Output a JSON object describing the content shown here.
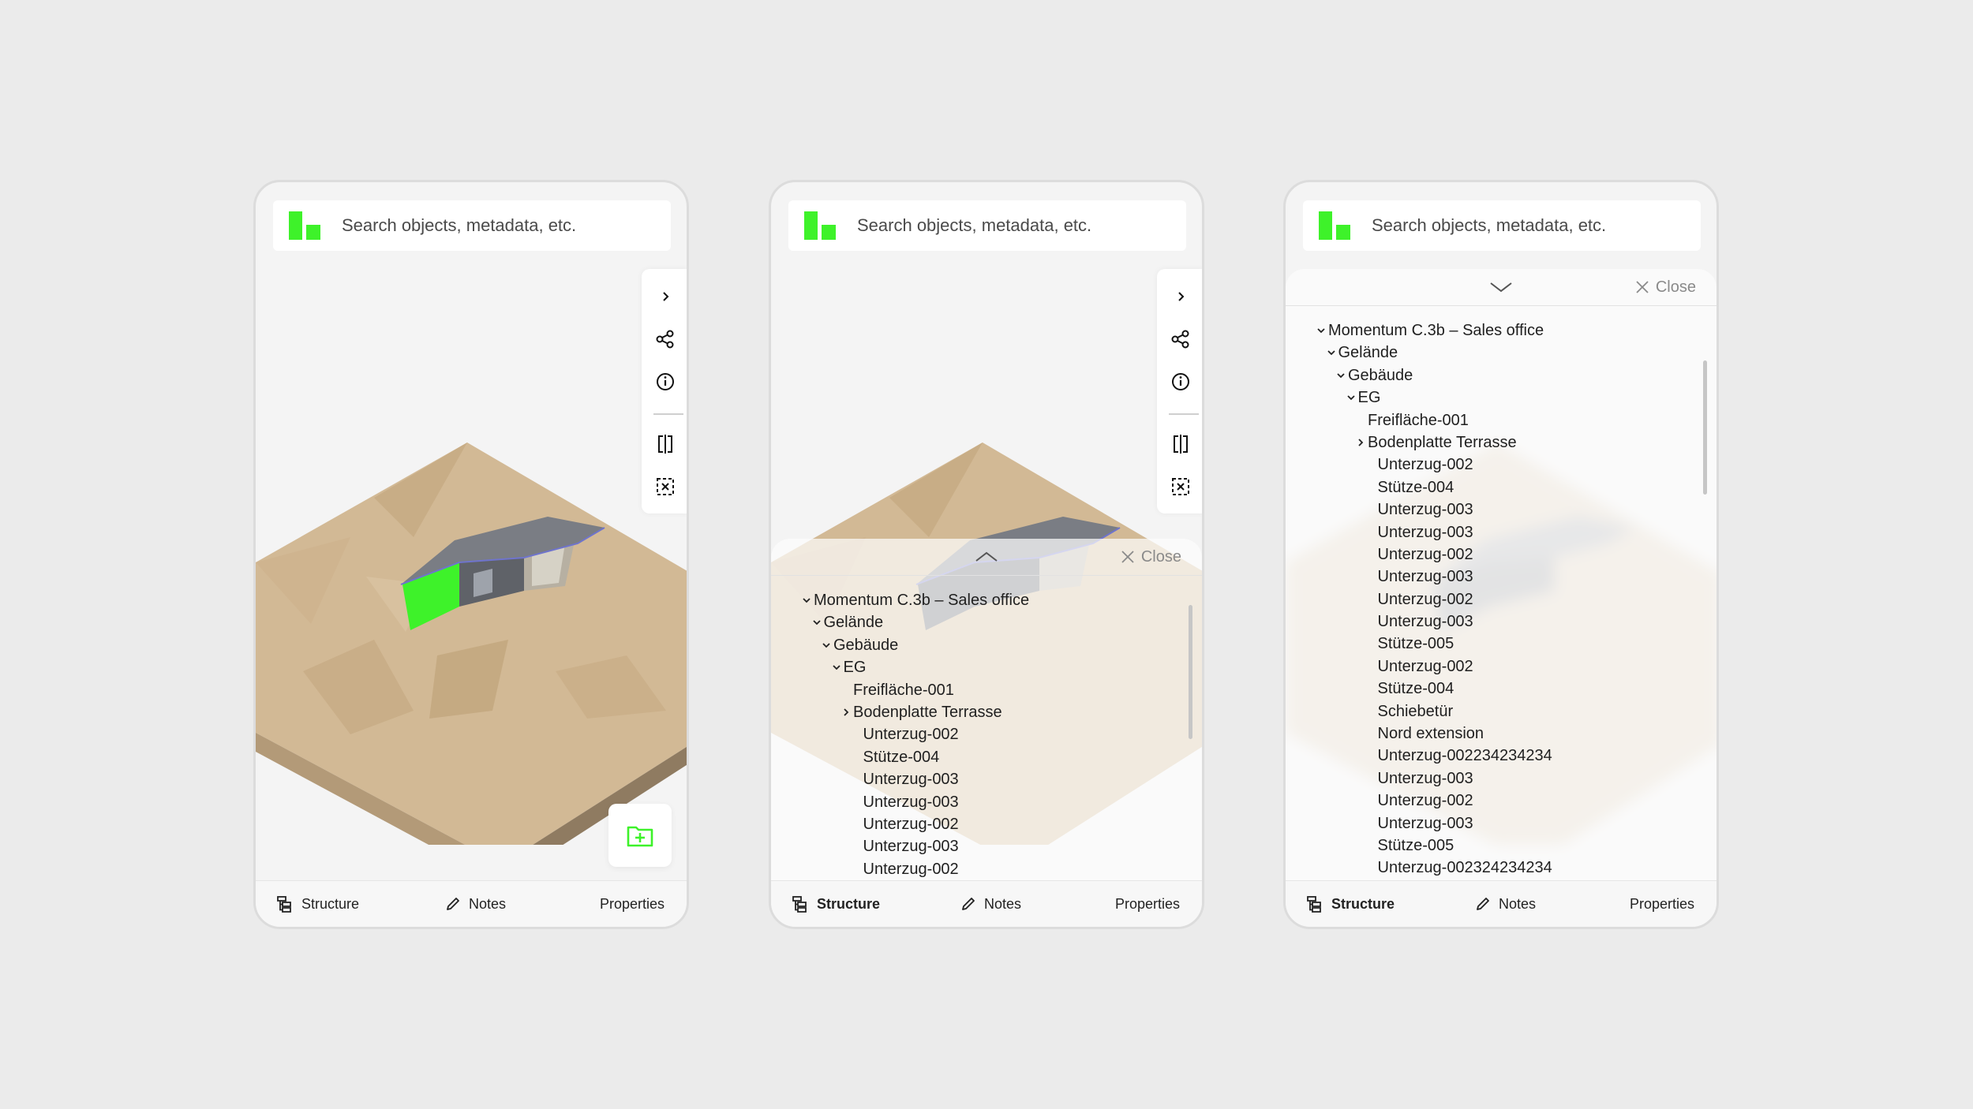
{
  "search": {
    "placeholder": "Search objects, metadata, etc."
  },
  "nav": {
    "structure": "Structure",
    "notes": "Notes",
    "properties": "Properties"
  },
  "sheet": {
    "close_label": "Close"
  },
  "tree": [
    {
      "label": "Momentum C.3b – Sales office",
      "level": 0,
      "caret": "open"
    },
    {
      "label": "Gelände",
      "level": 1,
      "caret": "open"
    },
    {
      "label": "Gebäude",
      "level": 2,
      "caret": "open"
    },
    {
      "label": "EG",
      "level": 3,
      "caret": "open"
    },
    {
      "label": "Freifläche-001",
      "level": 4,
      "caret": "none"
    },
    {
      "label": "Bodenplatte Terrasse",
      "level": 4,
      "caret": "closed"
    },
    {
      "label": "Unterzug-002",
      "level": 5,
      "caret": "none"
    },
    {
      "label": "Stütze-004",
      "level": 5,
      "caret": "none"
    },
    {
      "label": "Unterzug-003",
      "level": 5,
      "caret": "none"
    },
    {
      "label": "Unterzug-003",
      "level": 5,
      "caret": "none"
    },
    {
      "label": "Unterzug-002",
      "level": 5,
      "caret": "none"
    },
    {
      "label": "Unterzug-003",
      "level": 5,
      "caret": "none"
    },
    {
      "label": "Unterzug-002",
      "level": 5,
      "caret": "none"
    },
    {
      "label": "Unterzug-003",
      "level": 5,
      "caret": "none"
    },
    {
      "label": "Stütze-005",
      "level": 5,
      "caret": "none"
    },
    {
      "label": "Unterzug-002",
      "level": 5,
      "caret": "none"
    },
    {
      "label": "Stütze-004",
      "level": 5,
      "caret": "none"
    },
    {
      "label": "Schiebetür",
      "level": 5,
      "caret": "none"
    },
    {
      "label": "Nord extension",
      "level": 5,
      "caret": "none"
    },
    {
      "label": "Unterzug-002234234234",
      "level": 5,
      "caret": "none"
    },
    {
      "label": "Unterzug-003",
      "level": 5,
      "caret": "none"
    },
    {
      "label": "Unterzug-002",
      "level": 5,
      "caret": "none"
    },
    {
      "label": "Unterzug-003",
      "level": 5,
      "caret": "none"
    },
    {
      "label": "Stütze-005",
      "level": 5,
      "caret": "none"
    },
    {
      "label": "Unterzug-002324234234",
      "level": 5,
      "caret": "none"
    }
  ],
  "colors": {
    "brand_green": "#3ef22a",
    "terrain": "#d4bc98",
    "roof": "#7a7d84"
  },
  "icons": [
    "chevron-right-icon",
    "share-icon",
    "info-icon",
    "split-view-icon",
    "clear-selection-icon",
    "add-folder-icon",
    "structure-icon",
    "pencil-icon",
    "close-icon",
    "chevron-up-icon",
    "chevron-down-icon"
  ]
}
